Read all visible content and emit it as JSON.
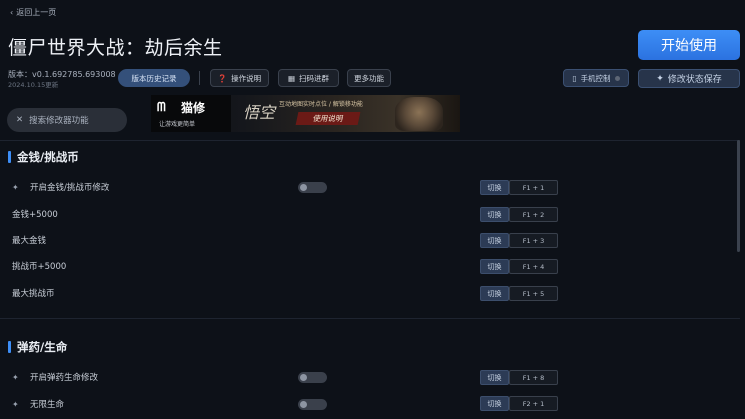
{
  "nav": {
    "back_label": "返回上一页"
  },
  "app": {
    "title": "僵尸世界大战：劫后余生",
    "version": "版本：v0.1.692785.693008",
    "updated": "2024.10.15更新",
    "start_label": "开始使用"
  },
  "toolbar": {
    "history": "版本历史记录",
    "ops": "操作说明",
    "scan": "扫码进群",
    "more": "更多功能",
    "phone": "手机控制",
    "save": "修改状态保存"
  },
  "search": {
    "placeholder": "搜索修改器功能"
  },
  "banner": {
    "brand": "猫修",
    "tagline": "让游戏更简单",
    "calligraphy": "悟空",
    "caption": "互动地图实时点位 / 解锁移功能",
    "button": "使用说明"
  },
  "sections": [
    {
      "title": "金钱/挑战币",
      "rows": [
        {
          "label": "开启金钱/挑战币修改",
          "type": "toggle",
          "toggle_on": false,
          "switch": "切换",
          "hotkey": "F1 + 1"
        },
        {
          "label": "金钱+5000",
          "type": "action",
          "switch": "切换",
          "hotkey": "F1 + 2"
        },
        {
          "label": "最大金钱",
          "type": "action",
          "switch": "切换",
          "hotkey": "F1 + 3"
        },
        {
          "label": "挑战币+5000",
          "type": "action",
          "switch": "切换",
          "hotkey": "F1 + 4"
        },
        {
          "label": "最大挑战币",
          "type": "action",
          "switch": "切换",
          "hotkey": "F1 + 5"
        }
      ]
    },
    {
      "title": "弹药/生命",
      "rows": [
        {
          "label": "开启弹药生命修改",
          "type": "toggle",
          "toggle_on": false,
          "switch": "切换",
          "hotkey": "F1 + 8"
        },
        {
          "label": "无限生命",
          "type": "toggle",
          "toggle_on": false,
          "switch": "切换",
          "hotkey": "F2 + 1"
        }
      ]
    }
  ],
  "colors": {
    "accent": "#3d8ef6",
    "background": "#0d1118"
  }
}
